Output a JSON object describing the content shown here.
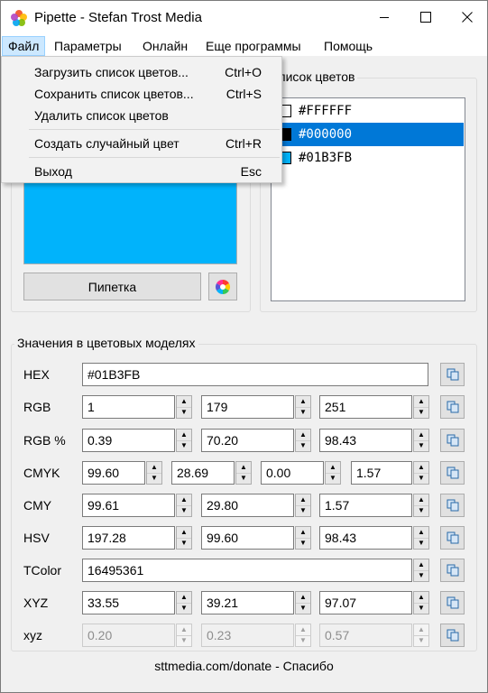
{
  "window": {
    "title": "Pipette - Stefan Trost Media"
  },
  "menu": [
    "Файл",
    "Параметры",
    "Онлайн",
    "Еще программы",
    "Помощь"
  ],
  "file_menu": {
    "items": [
      {
        "label": "Загрузить список цветов...",
        "shortcut": "Ctrl+O"
      },
      {
        "label": "Сохранить список цветов...",
        "shortcut": "Ctrl+S"
      },
      {
        "label": "Удалить список цветов",
        "shortcut": ""
      },
      {
        "label": "Создать случайный цвет",
        "shortcut": "Ctrl+R"
      },
      {
        "label": "Выход",
        "shortcut": "Esc"
      }
    ]
  },
  "color_list": {
    "title": "писок цветов",
    "items": [
      {
        "hex": "#FFFFFF",
        "color": "#ffffff",
        "selected": false
      },
      {
        "hex": "#000000",
        "color": "#000000",
        "selected": true
      },
      {
        "hex": "#01B3FB",
        "color": "#01b3fb",
        "selected": false
      }
    ]
  },
  "preview": {
    "color": "#01b3fb"
  },
  "pipette_button": "Пипетка",
  "models": {
    "title": "Значения в цветовых моделях",
    "hex": {
      "label": "HEX",
      "value": "#01B3FB"
    },
    "rgb": {
      "label": "RGB",
      "values": [
        "1",
        "179",
        "251"
      ]
    },
    "rgb_pct": {
      "label": "RGB %",
      "values": [
        "0.39",
        "70.20",
        "98.43"
      ]
    },
    "cmyk": {
      "label": "CMYK",
      "values": [
        "99.60",
        "28.69",
        "0.00",
        "1.57"
      ]
    },
    "cmy": {
      "label": "CMY",
      "values": [
        "99.61",
        "29.80",
        "1.57"
      ]
    },
    "hsv": {
      "label": "HSV",
      "values": [
        "197.28",
        "99.60",
        "98.43"
      ]
    },
    "tcolor": {
      "label": "TColor",
      "value": "16495361"
    },
    "xyz": {
      "label": "XYZ",
      "values": [
        "33.55",
        "39.21",
        "97.07"
      ]
    },
    "xyz_lower": {
      "label": "xyz",
      "values": [
        "0.20",
        "0.23",
        "0.57"
      ]
    }
  },
  "footer": "sttmedia.com/donate - Спасибо"
}
